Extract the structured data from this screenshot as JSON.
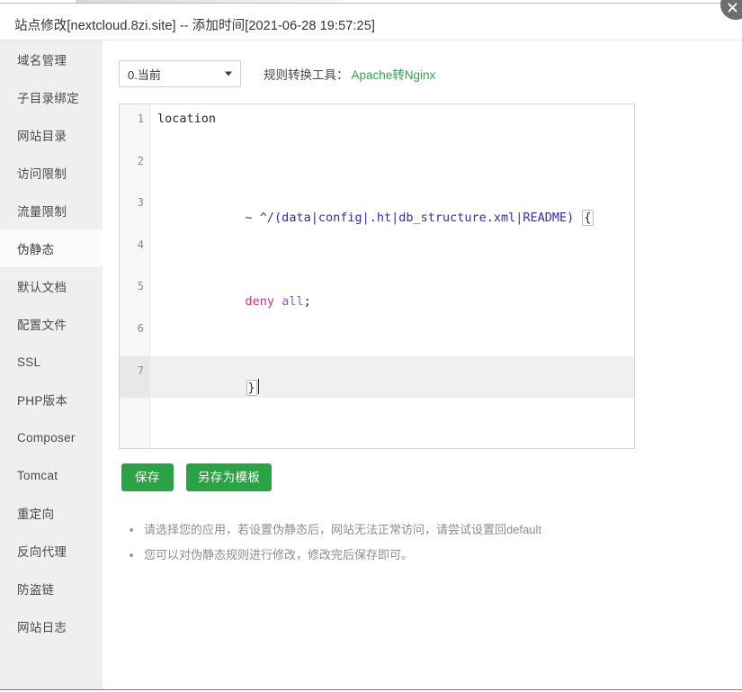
{
  "window": {
    "title": "站点修改[nextcloud.8zi.site] -- 添加时间[2021-06-28 19:57:25]",
    "close_icon": "close-icon"
  },
  "sidebar": {
    "active_index": 5,
    "items": [
      {
        "label": "域名管理"
      },
      {
        "label": "子目录绑定"
      },
      {
        "label": "网站目录"
      },
      {
        "label": "访问限制"
      },
      {
        "label": "流量限制"
      },
      {
        "label": "伪静态"
      },
      {
        "label": "默认文档"
      },
      {
        "label": "配置文件"
      },
      {
        "label": "SSL"
      },
      {
        "label": "PHP版本"
      },
      {
        "label": "Composer"
      },
      {
        "label": "Tomcat"
      },
      {
        "label": "重定向"
      },
      {
        "label": "反向代理"
      },
      {
        "label": "防盗链"
      },
      {
        "label": "网站日志"
      }
    ]
  },
  "toolbar": {
    "preset_select": {
      "value": "0.当前",
      "options": [
        "0.当前"
      ],
      "arrow_icon": "chevron-down-icon"
    },
    "converter_label": "规则转换工具：",
    "converter_link": "Apache转Nginx",
    "link_color": "#31a54c"
  },
  "editor": {
    "active_line": 7,
    "line_numbers": [
      "1",
      "2",
      "3",
      "4",
      "5",
      "6",
      "7"
    ],
    "lines": [
      {
        "n": "1",
        "text": "location"
      },
      {
        "n": "2",
        "text": ""
      },
      {
        "n": "3",
        "text": "~ ^/(data|config|.ht|db_structure.xml|README) {"
      },
      {
        "n": "4",
        "text": ""
      },
      {
        "n": "5",
        "text": "deny all;"
      },
      {
        "n": "6",
        "text": ""
      },
      {
        "n": "7",
        "text": "}"
      }
    ],
    "line1_token": "location",
    "line3_regex": "~ ^/(data|config|.ht|db_structure.xml|README) ",
    "line3_brace": "{",
    "line5_keyword": "deny",
    "line5_value": " all",
    "line5_semi": ";",
    "line7_brace": "}"
  },
  "buttons": {
    "save": "保存",
    "save_as_template": "另存为模板",
    "color": "#2ba245"
  },
  "hints": [
    "请选择您的应用，若设置伪静态后，网站无法正常访问，请尝试设置回default",
    "您可以对伪静态规则进行修改，修改完后保存即可。"
  ]
}
